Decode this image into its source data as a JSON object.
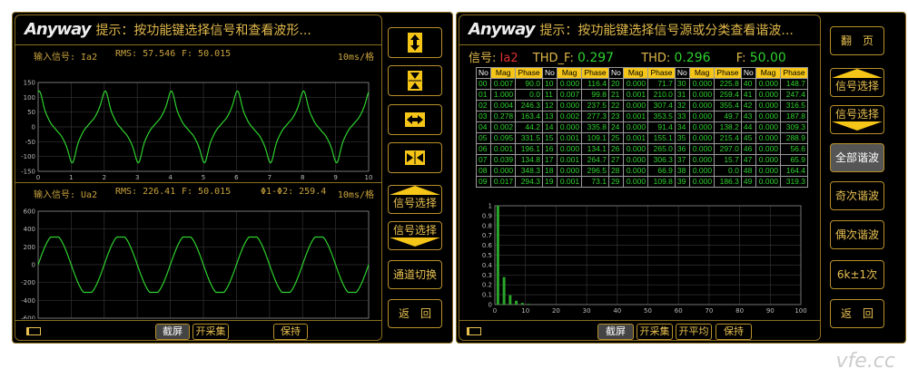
{
  "colors": {
    "frame": "#b8902a",
    "text": "#e0b84a",
    "trace": "#2ed12e",
    "header": "#f5c518"
  },
  "left": {
    "logo": "Anyway",
    "hint": "提示：按功能键选择信号和查看波形...",
    "ch1": {
      "signal": "输入信号: Ia2",
      "rms": "RMS: 57.546",
      "freq": "F: 50.015",
      "timebase": "10ms/格"
    },
    "ch2": {
      "signal": "输入信号: Ua2",
      "rms": "RMS: 226.41",
      "freq": "F: 50.015",
      "phase": "Φ1-Φ2: 259.4",
      "timebase": "10ms/格"
    },
    "side": {
      "icons": [
        "expand-vertical-icon",
        "compress-vertical-icon",
        "expand-horizontal-icon",
        "compress-horizontal-icon"
      ],
      "signal_up": "信号选择",
      "signal_down": "信号选择",
      "channel": "通道切换",
      "back": "返　回"
    },
    "bottom": {
      "screenshot": "截屏",
      "acquire": "开采集",
      "hold": "保持"
    }
  },
  "right": {
    "logo": "Anyway",
    "hint": "提示：按功能键选择信号源或分类查看谐波...",
    "signal_label": "信号:",
    "signal": "Ia2",
    "thdf_label": "THD_F:",
    "thdf": "0.297",
    "thd_label": "THD:",
    "thd": "0.296",
    "f_label": "F:",
    "f": "50.00",
    "table": {
      "headers": [
        "No",
        "Mag",
        "Phase"
      ],
      "rows": [
        [
          [
            "00",
            "0.007",
            "90.0"
          ],
          [
            "10",
            "0.000",
            "116.4"
          ],
          [
            "20",
            "0.000",
            "71.7"
          ],
          [
            "30",
            "0.000",
            "225.8"
          ],
          [
            "40",
            "0.000",
            "148.7"
          ]
        ],
        [
          [
            "01",
            "1.000",
            "0.0"
          ],
          [
            "11",
            "0.007",
            "99.8"
          ],
          [
            "21",
            "0.001",
            "210.0"
          ],
          [
            "31",
            "0.000",
            "259.4"
          ],
          [
            "41",
            "0.000",
            "247.4"
          ]
        ],
        [
          [
            "02",
            "0.004",
            "246.3"
          ],
          [
            "12",
            "0.000",
            "237.5"
          ],
          [
            "22",
            "0.000",
            "307.4"
          ],
          [
            "32",
            "0.000",
            "355.4"
          ],
          [
            "42",
            "0.000",
            "316.5"
          ]
        ],
        [
          [
            "03",
            "0.278",
            "163.4"
          ],
          [
            "13",
            "0.002",
            "277.3"
          ],
          [
            "23",
            "0.001",
            "353.5"
          ],
          [
            "33",
            "0.000",
            "49.7"
          ],
          [
            "43",
            "0.000",
            "187.8"
          ]
        ],
        [
          [
            "04",
            "0.002",
            "44.2"
          ],
          [
            "14",
            "0.000",
            "335.8"
          ],
          [
            "24",
            "0.000",
            "91.4"
          ],
          [
            "34",
            "0.000",
            "138.2"
          ],
          [
            "44",
            "0.000",
            "309.3"
          ]
        ],
        [
          [
            "05",
            "0.095",
            "331.5"
          ],
          [
            "15",
            "0.001",
            "109.1"
          ],
          [
            "25",
            "0.001",
            "155.1"
          ],
          [
            "35",
            "0.000",
            "215.4"
          ],
          [
            "45",
            "0.000",
            "288.9"
          ]
        ],
        [
          [
            "06",
            "0.001",
            "196.1"
          ],
          [
            "16",
            "0.000",
            "134.1"
          ],
          [
            "26",
            "0.000",
            "265.0"
          ],
          [
            "36",
            "0.000",
            "297.0"
          ],
          [
            "46",
            "0.000",
            "56.6"
          ]
        ],
        [
          [
            "07",
            "0.039",
            "134.8"
          ],
          [
            "17",
            "0.001",
            "264.7"
          ],
          [
            "27",
            "0.000",
            "306.3"
          ],
          [
            "37",
            "0.000",
            "15.7"
          ],
          [
            "47",
            "0.000",
            "65.9"
          ]
        ],
        [
          [
            "08",
            "0.000",
            "348.3"
          ],
          [
            "18",
            "0.000",
            "296.5"
          ],
          [
            "28",
            "0.000",
            "66.9"
          ],
          [
            "38",
            "0.000",
            "0.0"
          ],
          [
            "48",
            "0.000",
            "164.4"
          ]
        ],
        [
          [
            "09",
            "0.017",
            "294.3"
          ],
          [
            "19",
            "0.001",
            "73.1"
          ],
          [
            "29",
            "0.000",
            "109.8"
          ],
          [
            "39",
            "0.000",
            "186.3"
          ],
          [
            "49",
            "0.000",
            "319.3"
          ]
        ]
      ]
    },
    "side": {
      "page": "翻　页",
      "signal_up": "信号选择",
      "signal_down": "信号选择",
      "all": "全部谐波",
      "odd": "奇次谐波",
      "even": "偶次谐波",
      "k": "6k±1次",
      "back": "返　回"
    },
    "bottom": {
      "screenshot": "截屏",
      "acquire": "开采集",
      "average": "开平均",
      "hold": "保持"
    }
  },
  "chart_data": [
    {
      "type": "line",
      "name_printed": "",
      "xlim": [
        0,
        10
      ],
      "ylim": [
        -150,
        150
      ],
      "xticks": [
        0,
        1,
        2,
        3,
        4,
        5,
        6,
        7,
        8,
        9,
        10
      ],
      "yticks": [
        150,
        100,
        50,
        0,
        -50,
        -100,
        -150
      ],
      "grid": true,
      "waveform": {
        "fundamental_peak": 85,
        "period_divisions": 2,
        "harmonics": [
          [
            1,
            1.0,
            0.0
          ],
          [
            3,
            0.278,
            163.4
          ],
          [
            5,
            0.095,
            331.5
          ],
          [
            7,
            0.039,
            134.8
          ],
          [
            9,
            0.017,
            294.3
          ]
        ]
      }
    },
    {
      "type": "line",
      "xlim": [
        0,
        10
      ],
      "ylim": [
        -600,
        600
      ],
      "xticks": [
        0,
        1,
        2,
        3,
        4,
        5,
        6,
        7,
        8,
        9,
        10
      ],
      "yticks": [
        600,
        400,
        200,
        0,
        -200,
        -400,
        -600
      ],
      "grid": true,
      "waveform": {
        "peak": 310,
        "period_divisions": 2,
        "flat_top": true
      }
    },
    {
      "type": "bar",
      "xlim": [
        0,
        100
      ],
      "ylim": [
        0,
        1
      ],
      "xticks": [
        0,
        10,
        20,
        30,
        40,
        50,
        60,
        70,
        80,
        90,
        100
      ],
      "yticks": [
        0,
        0.1,
        0.2,
        0.3,
        0.4,
        0.5,
        0.6,
        0.7,
        0.8,
        0.9,
        1
      ],
      "grid": true,
      "x": [
        1,
        2,
        3,
        4,
        5,
        6,
        7,
        9,
        11
      ],
      "values": [
        1.0,
        0.004,
        0.278,
        0.002,
        0.095,
        0.001,
        0.039,
        0.017,
        0.007
      ]
    }
  ]
}
